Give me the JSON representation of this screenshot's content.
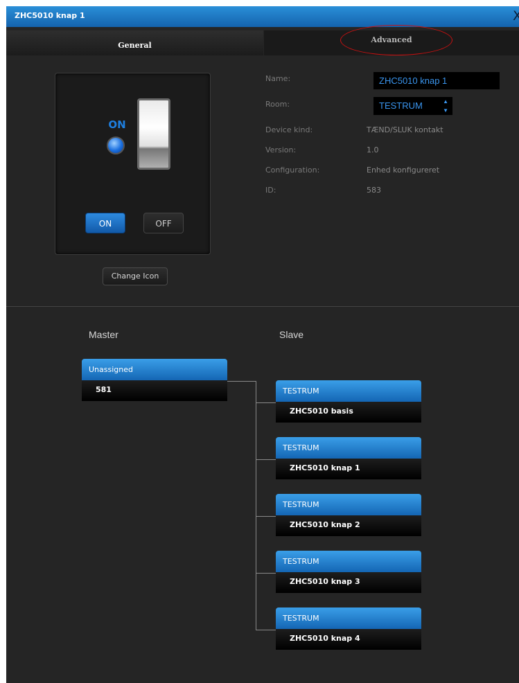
{
  "window": {
    "title": "ZHC5010 knap 1",
    "close_label": "X"
  },
  "tabs": [
    {
      "label": "General"
    },
    {
      "label": "Advanced"
    }
  ],
  "device_panel": {
    "indicator_label": "ON",
    "on_button": "ON",
    "off_button": "OFF",
    "change_icon_button": "Change Icon"
  },
  "properties": {
    "name_label": "Name:",
    "name_value": "ZHC5010 knap 1",
    "room_label": "Room:",
    "room_value": "TESTRUM",
    "device_kind_label": "Device kind:",
    "device_kind_value": "TÆND/SLUK kontakt",
    "version_label": "Version:",
    "version_value": "1.0",
    "configuration_label": "Configuration:",
    "configuration_value": "Enhed konfigureret",
    "id_label": "ID:",
    "id_value": "583"
  },
  "association": {
    "master_heading": "Master",
    "slave_heading": "Slave",
    "master": {
      "group": "Unassigned",
      "device": "581"
    },
    "slaves": [
      {
        "group": "TESTRUM",
        "device": "ZHC5010 basis"
      },
      {
        "group": "TESTRUM",
        "device": "ZHC5010 knap 1"
      },
      {
        "group": "TESTRUM",
        "device": "ZHC5010 knap 2"
      },
      {
        "group": "TESTRUM",
        "device": "ZHC5010 knap 3"
      },
      {
        "group": "TESTRUM",
        "device": "ZHC5010 knap 4"
      }
    ]
  },
  "colors": {
    "accent": "#1f7cd0",
    "background": "#252525",
    "annotation": "#cc1111"
  }
}
